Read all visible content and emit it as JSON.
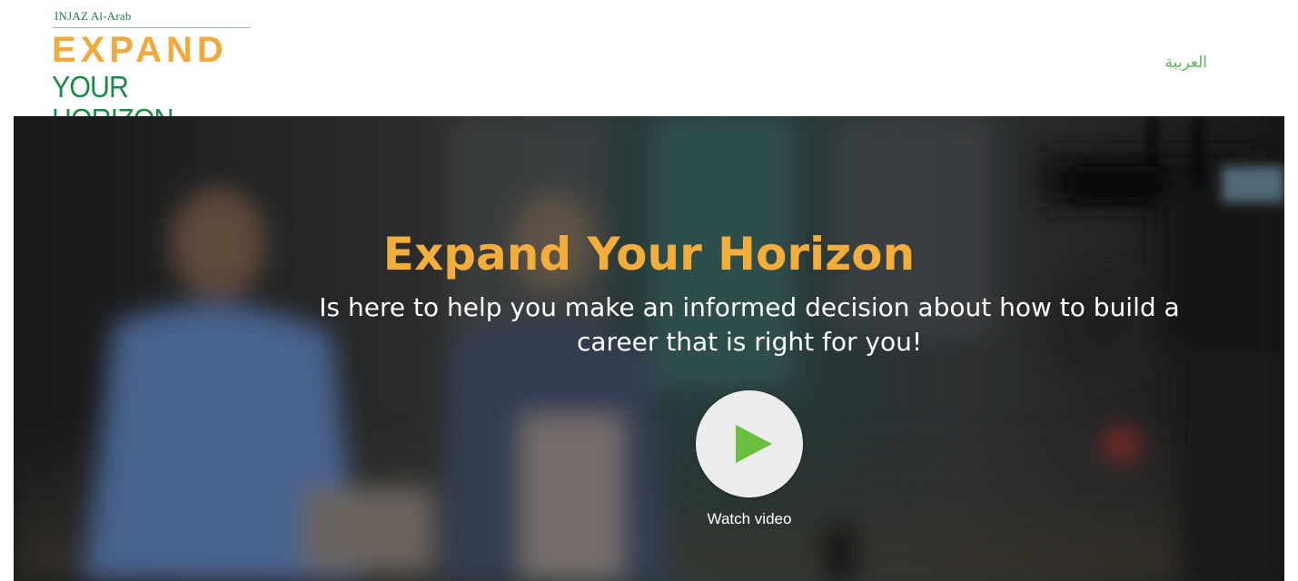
{
  "header": {
    "logo": {
      "org": "INJAZ Al-Arab",
      "line1": "EXPAND",
      "line2": "YOUR HORIZON"
    },
    "language_link": "العربية"
  },
  "hero": {
    "title": "Expand Your Horizon",
    "subtitle": "Is here to help you make an informed decision about how to build a career that is right for you!",
    "watch_label": "Watch video"
  },
  "colors": {
    "brand_orange": "#f2a93b",
    "brand_green": "#1a8a4a",
    "link_green": "#5cb85c",
    "play_green": "#6abf3e"
  }
}
